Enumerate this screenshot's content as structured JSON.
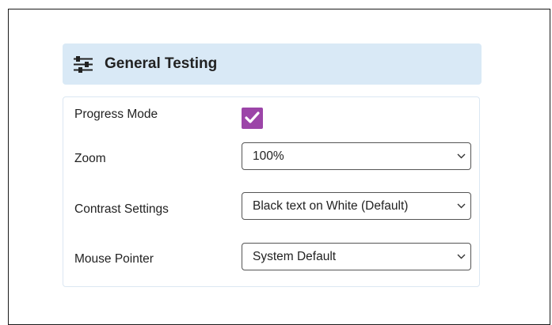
{
  "panel": {
    "title": "General Testing",
    "icon": "sliders-icon"
  },
  "settings": {
    "progress_mode": {
      "label": "Progress Mode",
      "checked": true,
      "accent_color": "#9c45a8"
    },
    "zoom": {
      "label": "Zoom",
      "value": "100%"
    },
    "contrast": {
      "label": "Contrast Settings",
      "value": "Black text on White (Default)"
    },
    "mouse_pointer": {
      "label": "Mouse Pointer",
      "value": "System Default"
    }
  },
  "colors": {
    "header_background": "#d9e9f6",
    "panel_border": "#dbe7f2"
  }
}
